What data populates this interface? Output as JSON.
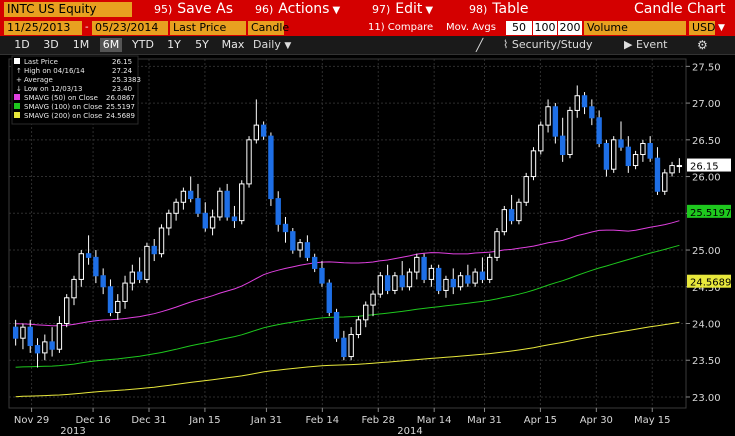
{
  "toolbar": {
    "security": "INTC US Equity",
    "menus": [
      {
        "num": "95)",
        "label": "Save As"
      },
      {
        "num": "96)",
        "label": "Actions"
      },
      {
        "num": "97)",
        "label": "Edit"
      },
      {
        "num": "98)",
        "label": "Table"
      }
    ],
    "title": "Candle Chart"
  },
  "params": {
    "start": "11/25/2013",
    "end": "05/23/2014",
    "price_field": "Last Price",
    "style": "Candle",
    "compare": "11) Compare",
    "mov_avgs_label": "Mov. Avgs",
    "ma1": "50",
    "ma2": "100",
    "ma3": "200",
    "volume": "Volume",
    "currency": "USD"
  },
  "tabs": [
    "1D",
    "3D",
    "1M",
    "6M",
    "YTD",
    "1Y",
    "5Y",
    "Max"
  ],
  "active_tab": "6M",
  "interval": "Daily",
  "tools": {
    "security_study": "Security/Study",
    "event": "Event"
  },
  "colors": {
    "up_candle": "#ffffff",
    "down_candle": "#1e6fe6",
    "sma50": "#e040e0",
    "sma100": "#1ec81e",
    "sma200": "#e8e83c"
  },
  "chart_data": {
    "type": "candlestick",
    "y_axis_ticks": [
      "27.50",
      "27.00",
      "26.50",
      "26.00",
      "25.50",
      "25.00",
      "24.50",
      "24.00",
      "23.50",
      "23.00"
    ],
    "ylim": [
      22.85,
      27.6
    ],
    "x_axis_ticks": [
      "Nov 29",
      "Dec 16",
      "Dec 31",
      "Jan 15",
      "Jan 31",
      "Feb 14",
      "Feb 28",
      "Mar 14",
      "Mar 31",
      "Apr 15",
      "Apr 30",
      "May 15"
    ],
    "year_labels": [
      "2013",
      "2014"
    ],
    "legend": [
      {
        "label": "Last Price",
        "value": "26.15"
      },
      {
        "label": "High on 04/16/14",
        "value": "27.24"
      },
      {
        "label": "Average",
        "value": "25.3383"
      },
      {
        "label": "Low on 12/03/13",
        "value": "23.40"
      },
      {
        "label": "SMAVG (50) on Close",
        "value": "26.0867"
      },
      {
        "label": "SMAVG (100) on Close",
        "value": "25.5197"
      },
      {
        "label": "SMAVG (200) on Close",
        "value": "24.5689"
      }
    ],
    "value_tags": [
      "26.15",
      "25.5197",
      "24.5689"
    ],
    "candles": [
      {
        "o": 23.95,
        "h": 24.05,
        "l": 23.7,
        "c": 23.8
      },
      {
        "o": 23.8,
        "h": 24.0,
        "l": 23.65,
        "c": 23.95
      },
      {
        "o": 23.95,
        "h": 24.05,
        "l": 23.6,
        "c": 23.7
      },
      {
        "o": 23.7,
        "h": 23.8,
        "l": 23.4,
        "c": 23.6
      },
      {
        "o": 23.6,
        "h": 23.85,
        "l": 23.5,
        "c": 23.75
      },
      {
        "o": 23.75,
        "h": 23.95,
        "l": 23.55,
        "c": 23.65
      },
      {
        "o": 23.65,
        "h": 24.1,
        "l": 23.6,
        "c": 24.0
      },
      {
        "o": 24.0,
        "h": 24.4,
        "l": 23.95,
        "c": 24.35
      },
      {
        "o": 24.35,
        "h": 24.65,
        "l": 24.25,
        "c": 24.6
      },
      {
        "o": 24.6,
        "h": 25.0,
        "l": 24.5,
        "c": 24.95
      },
      {
        "o": 24.95,
        "h": 25.2,
        "l": 24.8,
        "c": 24.9
      },
      {
        "o": 24.9,
        "h": 25.0,
        "l": 24.55,
        "c": 24.65
      },
      {
        "o": 24.65,
        "h": 24.75,
        "l": 24.4,
        "c": 24.5
      },
      {
        "o": 24.5,
        "h": 24.6,
        "l": 24.1,
        "c": 24.15
      },
      {
        "o": 24.15,
        "h": 24.4,
        "l": 24.05,
        "c": 24.3
      },
      {
        "o": 24.3,
        "h": 24.65,
        "l": 24.2,
        "c": 24.55
      },
      {
        "o": 24.55,
        "h": 24.8,
        "l": 24.45,
        "c": 24.7
      },
      {
        "o": 24.7,
        "h": 24.9,
        "l": 24.55,
        "c": 24.6
      },
      {
        "o": 24.6,
        "h": 25.1,
        "l": 24.55,
        "c": 25.05
      },
      {
        "o": 25.05,
        "h": 25.15,
        "l": 24.85,
        "c": 24.95
      },
      {
        "o": 24.95,
        "h": 25.35,
        "l": 24.9,
        "c": 25.3
      },
      {
        "o": 25.3,
        "h": 25.55,
        "l": 25.2,
        "c": 25.5
      },
      {
        "o": 25.5,
        "h": 25.7,
        "l": 25.4,
        "c": 25.65
      },
      {
        "o": 25.65,
        "h": 25.85,
        "l": 25.55,
        "c": 25.8
      },
      {
        "o": 25.8,
        "h": 26.0,
        "l": 25.65,
        "c": 25.7
      },
      {
        "o": 25.7,
        "h": 25.9,
        "l": 25.45,
        "c": 25.5
      },
      {
        "o": 25.5,
        "h": 25.65,
        "l": 25.25,
        "c": 25.3
      },
      {
        "o": 25.3,
        "h": 25.55,
        "l": 25.2,
        "c": 25.45
      },
      {
        "o": 25.45,
        "h": 25.85,
        "l": 25.4,
        "c": 25.8
      },
      {
        "o": 25.8,
        "h": 25.9,
        "l": 25.4,
        "c": 25.45
      },
      {
        "o": 25.45,
        "h": 25.6,
        "l": 25.3,
        "c": 25.4
      },
      {
        "o": 25.4,
        "h": 25.95,
        "l": 25.35,
        "c": 25.9
      },
      {
        "o": 25.9,
        "h": 26.55,
        "l": 25.85,
        "c": 26.5
      },
      {
        "o": 26.5,
        "h": 27.05,
        "l": 26.45,
        "c": 26.7
      },
      {
        "o": 26.7,
        "h": 26.75,
        "l": 26.5,
        "c": 26.55
      },
      {
        "o": 26.55,
        "h": 26.6,
        "l": 25.6,
        "c": 25.7
      },
      {
        "o": 25.7,
        "h": 25.8,
        "l": 25.25,
        "c": 25.35
      },
      {
        "o": 25.35,
        "h": 25.45,
        "l": 25.1,
        "c": 25.25
      },
      {
        "o": 25.25,
        "h": 25.3,
        "l": 24.95,
        "c": 25.0
      },
      {
        "o": 25.0,
        "h": 25.15,
        "l": 24.9,
        "c": 25.1
      },
      {
        "o": 25.1,
        "h": 25.2,
        "l": 24.85,
        "c": 24.9
      },
      {
        "o": 24.9,
        "h": 24.95,
        "l": 24.7,
        "c": 24.75
      },
      {
        "o": 24.75,
        "h": 24.85,
        "l": 24.5,
        "c": 24.55
      },
      {
        "o": 24.55,
        "h": 24.6,
        "l": 24.1,
        "c": 24.15
      },
      {
        "o": 24.15,
        "h": 24.2,
        "l": 23.75,
        "c": 23.8
      },
      {
        "o": 23.8,
        "h": 23.9,
        "l": 23.5,
        "c": 23.55
      },
      {
        "o": 23.55,
        "h": 23.95,
        "l": 23.5,
        "c": 23.85
      },
      {
        "o": 23.85,
        "h": 24.1,
        "l": 23.8,
        "c": 24.05
      },
      {
        "o": 24.05,
        "h": 24.3,
        "l": 23.95,
        "c": 24.25
      },
      {
        "o": 24.25,
        "h": 24.45,
        "l": 24.1,
        "c": 24.4
      },
      {
        "o": 24.4,
        "h": 24.7,
        "l": 24.35,
        "c": 24.65
      },
      {
        "o": 24.65,
        "h": 24.8,
        "l": 24.4,
        "c": 24.45
      },
      {
        "o": 24.45,
        "h": 24.7,
        "l": 24.4,
        "c": 24.65
      },
      {
        "o": 24.65,
        "h": 24.85,
        "l": 24.45,
        "c": 24.5
      },
      {
        "o": 24.5,
        "h": 24.75,
        "l": 24.45,
        "c": 24.7
      },
      {
        "o": 24.7,
        "h": 24.95,
        "l": 24.6,
        "c": 24.9
      },
      {
        "o": 24.9,
        "h": 24.95,
        "l": 24.55,
        "c": 24.6
      },
      {
        "o": 24.6,
        "h": 24.8,
        "l": 24.5,
        "c": 24.75
      },
      {
        "o": 24.75,
        "h": 24.8,
        "l": 24.4,
        "c": 24.45
      },
      {
        "o": 24.45,
        "h": 24.65,
        "l": 24.35,
        "c": 24.6
      },
      {
        "o": 24.6,
        "h": 24.75,
        "l": 24.4,
        "c": 24.5
      },
      {
        "o": 24.5,
        "h": 24.7,
        "l": 24.45,
        "c": 24.65
      },
      {
        "o": 24.65,
        "h": 24.8,
        "l": 24.5,
        "c": 24.55
      },
      {
        "o": 24.55,
        "h": 24.75,
        "l": 24.5,
        "c": 24.7
      },
      {
        "o": 24.7,
        "h": 24.9,
        "l": 24.55,
        "c": 24.6
      },
      {
        "o": 24.6,
        "h": 24.95,
        "l": 24.55,
        "c": 24.9
      },
      {
        "o": 24.9,
        "h": 25.3,
        "l": 24.85,
        "c": 25.25
      },
      {
        "o": 25.25,
        "h": 25.6,
        "l": 25.2,
        "c": 25.55
      },
      {
        "o": 25.55,
        "h": 25.75,
        "l": 25.35,
        "c": 25.4
      },
      {
        "o": 25.4,
        "h": 25.7,
        "l": 25.35,
        "c": 25.65
      },
      {
        "o": 25.65,
        "h": 26.05,
        "l": 25.6,
        "c": 26.0
      },
      {
        "o": 26.0,
        "h": 26.4,
        "l": 25.95,
        "c": 26.35
      },
      {
        "o": 26.35,
        "h": 26.75,
        "l": 26.3,
        "c": 26.7
      },
      {
        "o": 26.7,
        "h": 27.05,
        "l": 26.6,
        "c": 26.95
      },
      {
        "o": 26.95,
        "h": 27.0,
        "l": 26.45,
        "c": 26.55
      },
      {
        "o": 26.55,
        "h": 26.8,
        "l": 26.2,
        "c": 26.3
      },
      {
        "o": 26.3,
        "h": 26.95,
        "l": 26.25,
        "c": 26.9
      },
      {
        "o": 26.9,
        "h": 27.24,
        "l": 26.8,
        "c": 27.1
      },
      {
        "o": 27.1,
        "h": 27.15,
        "l": 26.85,
        "c": 26.95
      },
      {
        "o": 26.95,
        "h": 27.05,
        "l": 26.7,
        "c": 26.8
      },
      {
        "o": 26.8,
        "h": 26.9,
        "l": 26.4,
        "c": 26.45
      },
      {
        "o": 26.45,
        "h": 26.5,
        "l": 26.0,
        "c": 26.1
      },
      {
        "o": 26.1,
        "h": 26.55,
        "l": 26.05,
        "c": 26.5
      },
      {
        "o": 26.5,
        "h": 26.75,
        "l": 26.35,
        "c": 26.4
      },
      {
        "o": 26.4,
        "h": 26.55,
        "l": 26.05,
        "c": 26.15
      },
      {
        "o": 26.15,
        "h": 26.35,
        "l": 26.1,
        "c": 26.3
      },
      {
        "o": 26.3,
        "h": 26.5,
        "l": 26.2,
        "c": 26.45
      },
      {
        "o": 26.45,
        "h": 26.55,
        "l": 26.2,
        "c": 26.25
      },
      {
        "o": 26.25,
        "h": 26.4,
        "l": 25.75,
        "c": 25.8
      },
      {
        "o": 25.8,
        "h": 26.1,
        "l": 25.75,
        "c": 26.05
      },
      {
        "o": 26.05,
        "h": 26.2,
        "l": 26.0,
        "c": 26.15
      },
      {
        "o": 26.15,
        "h": 26.25,
        "l": 26.05,
        "c": 26.15
      }
    ]
  }
}
